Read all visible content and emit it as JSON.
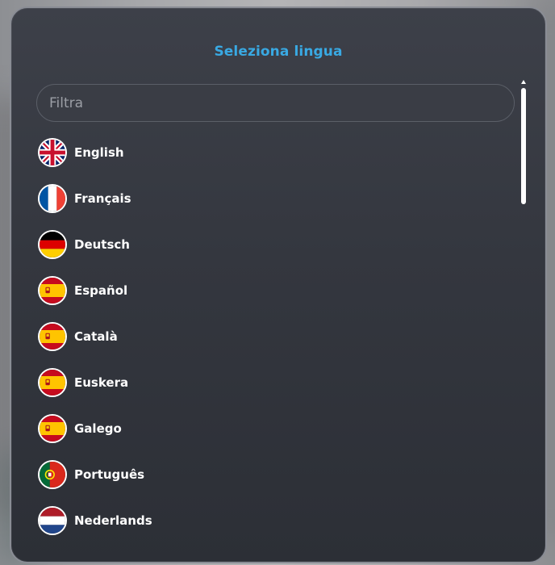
{
  "dialog": {
    "title": "Seleziona lingua",
    "filter_placeholder": "Filtra",
    "filter_value": ""
  },
  "languages": [
    {
      "label": "English",
      "flag": "uk-flag-icon"
    },
    {
      "label": "Français",
      "flag": "france-flag-icon"
    },
    {
      "label": "Deutsch",
      "flag": "germany-flag-icon"
    },
    {
      "label": "Español",
      "flag": "spain-flag-icon"
    },
    {
      "label": "Català",
      "flag": "spain-flag-icon"
    },
    {
      "label": "Euskera",
      "flag": "spain-flag-icon"
    },
    {
      "label": "Galego",
      "flag": "spain-flag-icon"
    },
    {
      "label": "Português",
      "flag": "portugal-flag-icon"
    },
    {
      "label": "Nederlands",
      "flag": "netherlands-flag-icon"
    }
  ],
  "colors": {
    "title_accent": "#39a9e3",
    "panel_background": "#34373f",
    "text": "#ffffff"
  }
}
